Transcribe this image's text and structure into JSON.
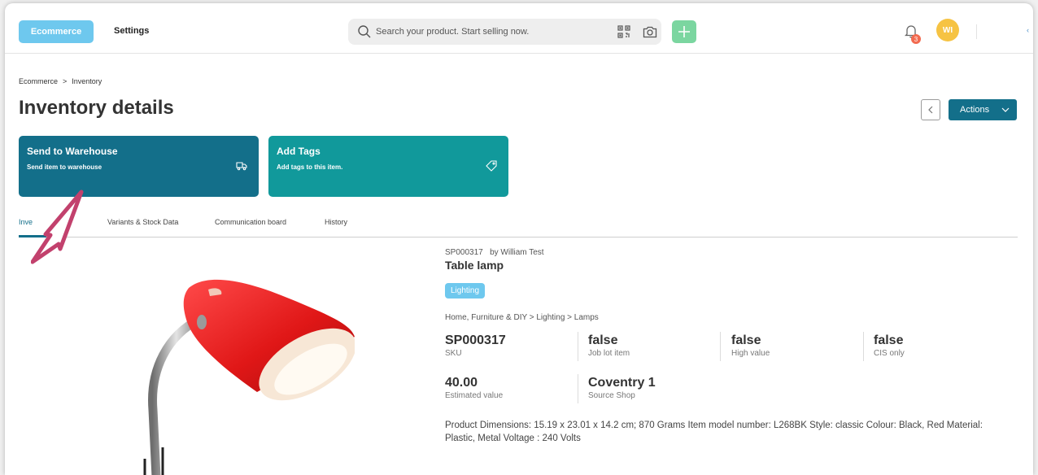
{
  "topbar": {
    "nav_ecommerce": "Ecommerce",
    "nav_settings": "Settings",
    "search_placeholder": "Search your product. Start selling now.",
    "notification_count": "3",
    "avatar_initials": "WI",
    "edge_glyph": "‹"
  },
  "breadcrumb": {
    "root": "Ecommerce",
    "separator": ">",
    "current": "Inventory"
  },
  "page": {
    "title": "Inventory details",
    "actions_label": "Actions"
  },
  "cards": [
    {
      "title": "Send to Warehouse",
      "subtitle": "Send item to warehouse",
      "icon": "truck-icon",
      "color": "#136f8a"
    },
    {
      "title": "Add Tags",
      "subtitle": "Add tags to this item.",
      "icon": "tag-icon",
      "color": "#11999b"
    }
  ],
  "tabs": [
    {
      "label": "Inventory",
      "visible_text": "Inve",
      "active": true
    },
    {
      "label": "Variants & Stock Data",
      "active": false
    },
    {
      "label": "Communication board",
      "active": false
    },
    {
      "label": "History",
      "active": false
    }
  ],
  "product": {
    "code": "SP000317",
    "by": "by William Test",
    "name": "Table lamp",
    "category_badge": "Lighting",
    "category_path": "Home, Furniture & DIY > Lighting > Lamps",
    "attributes": [
      {
        "value": "SP000317",
        "label": "SKU"
      },
      {
        "value": "false",
        "label": "Job lot item"
      },
      {
        "value": "false",
        "label": "High value"
      },
      {
        "value": "false",
        "label": "CIS only"
      },
      {
        "value": "40.00",
        "label": "Estimated value"
      },
      {
        "value": "Coventry 1",
        "label": "Source Shop"
      }
    ],
    "description": "Product Dimensions: 15.19 x 23.01 x 14.2 cm; 870 Grams Item model number: L268BK Style: classic Colour: Black, Red Material: Plastic, Metal Voltage : 240 Volts"
  },
  "colors": {
    "primary": "#136f8a",
    "teal": "#11999b",
    "light_blue": "#6ec8ee",
    "green": "#7bd6a0",
    "avatar": "#f6c343",
    "badge": "#f26a4f",
    "pointer": "#c2416d"
  }
}
